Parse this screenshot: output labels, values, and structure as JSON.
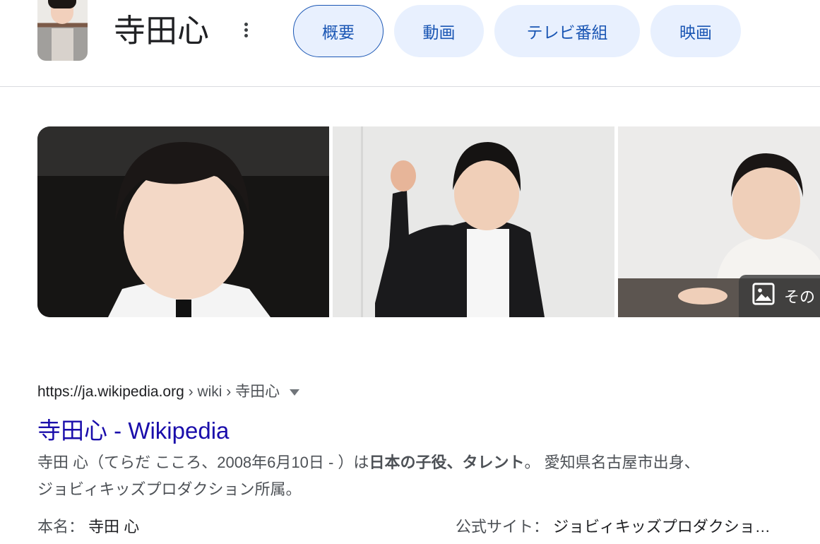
{
  "header": {
    "title": "寺田心",
    "tabs": [
      {
        "label": "概要"
      },
      {
        "label": "動画"
      },
      {
        "label": "テレビ番組"
      },
      {
        "label": "映画"
      }
    ]
  },
  "images": {
    "more_label": "その"
  },
  "result": {
    "url_host": "https://ja.wikipedia.org",
    "url_crumb": " › wiki › 寺田心",
    "title": "寺田心 - Wikipedia",
    "snippet_pre": "寺田 心（てらだ こころ、2008年6月10日 - ）は",
    "snippet_bold": "日本の子役、タレント",
    "snippet_post": "。 愛知県名古屋市出身、",
    "snippet_line2": "ジョビィキッズプロダクション所属。",
    "fact1_label": "本名：",
    "fact1_value": "寺田 心",
    "fact2_label": "公式サイト：",
    "fact2_value": "ジョビィキッズプロダクショ…"
  }
}
